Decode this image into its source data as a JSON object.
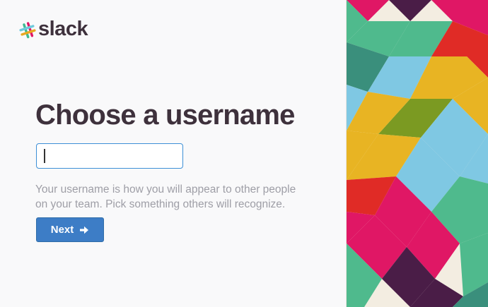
{
  "brand": {
    "logo_text": "slack",
    "logo_icon": "slack-hash-icon"
  },
  "form": {
    "title": "Choose a username",
    "input_value": "",
    "hint_line1": "Your username is how you will appear to other people",
    "hint_line2": "on your team. Pick something others will recognize.",
    "next_label": "Next",
    "next_icon": "arrow-right-icon"
  },
  "colors": {
    "text_dark": "#3e313c",
    "hint_gray": "#9e9ea6",
    "button_blue": "#3d7dc6",
    "input_focus_border": "#3d8fd6",
    "pattern_green": "#4fba8d",
    "pattern_magenta": "#e01765",
    "pattern_blue": "#7fc8e3",
    "pattern_yellow": "#e8b423",
    "pattern_olive": "#7b9a22",
    "pattern_red": "#e02b26",
    "pattern_teal": "#3a8f7c",
    "pattern_purple": "#4a1d47",
    "pattern_cream": "#f3ede1"
  }
}
